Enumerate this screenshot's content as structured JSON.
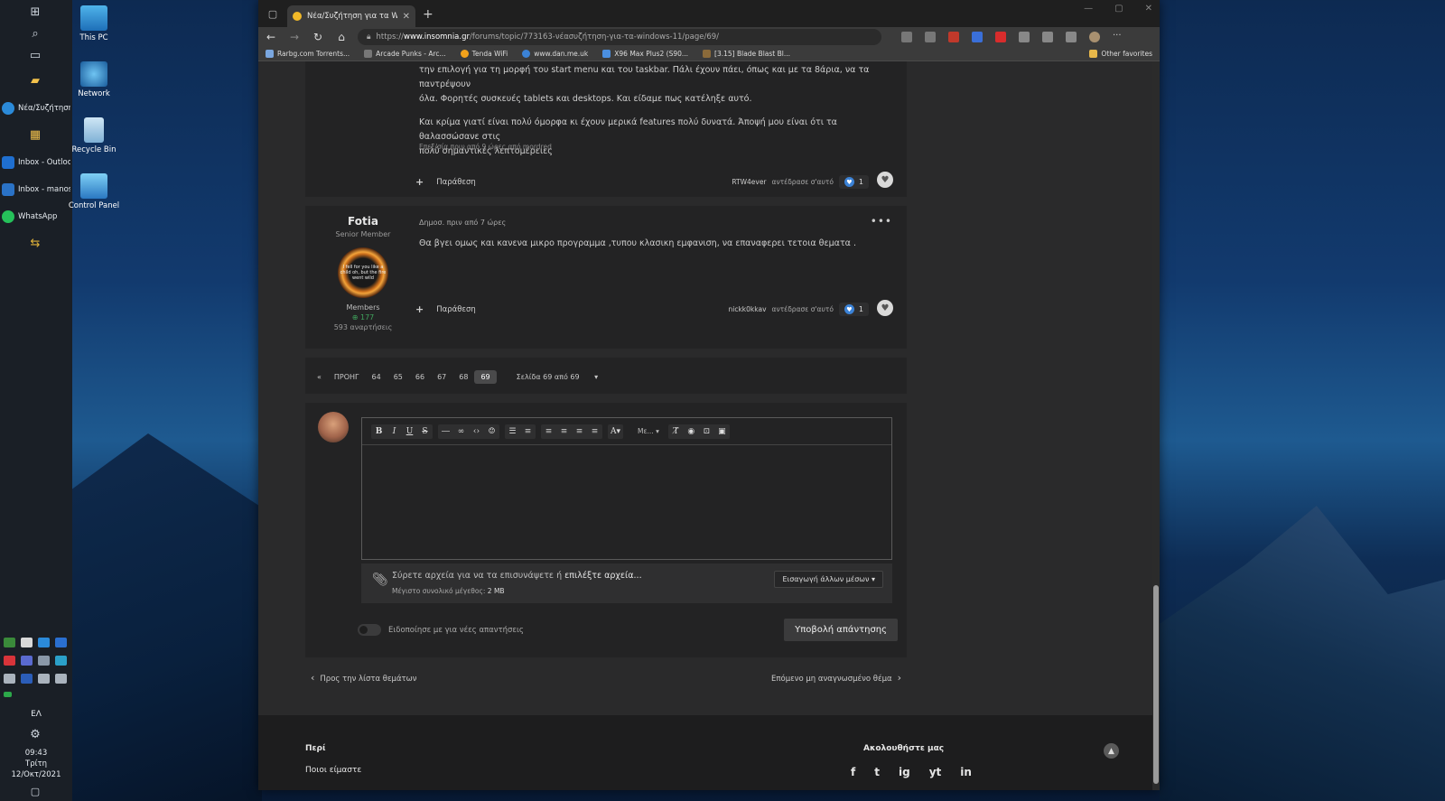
{
  "desktop": {
    "icons": [
      {
        "label": "This PC"
      },
      {
        "label": "Network"
      },
      {
        "label": "Recycle Bin"
      },
      {
        "label": "Control Panel"
      }
    ]
  },
  "taskbar": {
    "apps": [
      {
        "label": "Νέα/Συζήτηση...",
        "color": "#2b8ad9"
      },
      {
        "label": "Inbox - Outloo...",
        "color": "#1f6fd0"
      },
      {
        "label": "Inbox - manos...",
        "color": "#2a72c6"
      },
      {
        "label": "WhatsApp",
        "color": "#25c15a"
      }
    ],
    "lang": "ΕΛ",
    "time": "09:43",
    "day": "Τρίτη",
    "date": "12/Οκτ/2021"
  },
  "browser": {
    "tab_title": "Νέα/Συζήτηση για τα Windows 11",
    "url_prefix": "https://",
    "url_host": "www.insomnia.gr",
    "url_path": "/forums/topic/773163-νέασυζήτηση-για-τα-windows-11/page/69/",
    "favorites": [
      {
        "label": "Rarbg.com Torrents...",
        "color": "#7aa7e0"
      },
      {
        "label": "Arcade Punks - Arc...",
        "color": "#777"
      },
      {
        "label": "Tenda WiFi",
        "color": "#f2a21b"
      },
      {
        "label": "www.dan.me.uk",
        "color": "#3b82d6"
      },
      {
        "label": "X96 Max Plus2 (S90...",
        "color": "#4b8fe0"
      },
      {
        "label": "[3.15] Blade Blast Bl...",
        "color": "#8a6a3a"
      }
    ],
    "other_favorites": "Other favorites"
  },
  "post1": {
    "line1": "την επιλογή για τη μορφή του start menu και του taskbar. Πάλι έχουν πάει, όπως και με τα 8άρια, να τα παντρέψουν",
    "line2": "όλα. Φορητές συσκευές tablets και desktops. Και είδαμε πως κατέληξε αυτό.",
    "line3": "Και κρίμα γιατί είναι πολύ όμορφα κι έχουν μερικά features πολύ δυνατά. Άποψή μου είναι ότι τα θαλασσώσανε στις",
    "line4": "πολύ σημαντικές λεπτομέρειες",
    "edited": "Επεξ/σία πριν από 9 ώρες από mordred",
    "quote": "Παράθεση",
    "reacted_by": "RTW4ever",
    "reacted_text": "αντέδρασε σ'αυτό",
    "count": "1"
  },
  "post2": {
    "author": "Fotia",
    "role": "Senior Member",
    "avatar_text": "I fell for you like a child oh, but the fire went wild",
    "group": "Members",
    "rep": "177",
    "posts": "593 αναρτήσεις",
    "meta": "Δημοσ. πριν από 7 ώρες",
    "text": "Θα βγει ομως και κανενα μικρο προγραμμα ,τυπου κλασικη εμφανιση, να επαναφερει τετοια θεματα  .",
    "quote": "Παράθεση",
    "reacted_by": "nickk0kkav",
    "reacted_text": "αντέδρασε σ'αυτό",
    "count": "1"
  },
  "pager": {
    "first": "«",
    "prev": "ΠΡΟΗΓ",
    "pages": [
      "64",
      "65",
      "66",
      "67",
      "68",
      "69"
    ],
    "current": "69",
    "select": "Σελίδα 69 από 69"
  },
  "editor": {
    "font_label": "Με...",
    "drop_text": "Σύρετε αρχεία για να τα επισυνάψετε ή ",
    "choose_link": "επιλέξτε αρχεία...",
    "max_label": "Μέγιστο συνολικό μέγεθος: ",
    "max_value": "2 MB",
    "insert_media": "Εισαγωγή άλλων μέσων",
    "notify": "Ειδοποίησε με για νέες απαντήσεις",
    "submit": "Υποβολή απάντησης"
  },
  "nav": {
    "back": "Προς την λίστα θεμάτων",
    "next": "Επόμενο μη αναγνωσμένο θέμα"
  },
  "footer": {
    "about_title": "Περί",
    "about_link": "Ποιοι είμαστε",
    "follow_title": "Ακολουθήστε μας",
    "social": [
      "f",
      "t",
      "ig",
      "yt",
      "in"
    ]
  },
  "colors": {
    "accent_reaction": "#3b82d6",
    "reputation": "#3fa35c"
  }
}
